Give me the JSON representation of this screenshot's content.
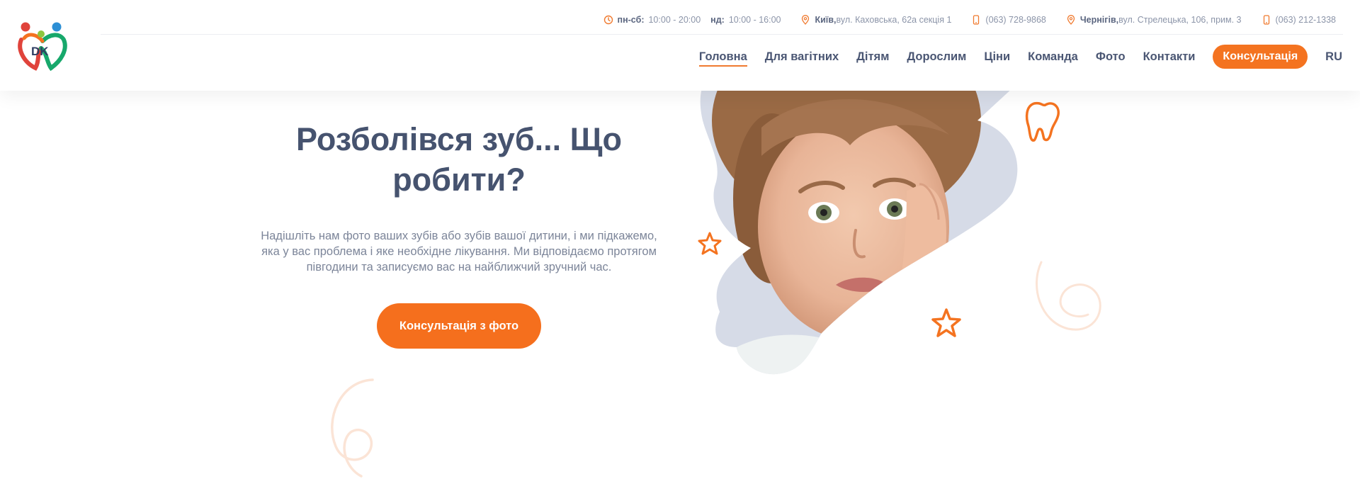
{
  "brand": {
    "logo_text": "DK",
    "colors": {
      "accent": "#f47320",
      "text": "#46536f",
      "muted": "#7c8599",
      "logo_red": "#e0433b",
      "logo_green": "#17a86b",
      "logo_blue": "#2d8fd5"
    }
  },
  "topbar": {
    "hours_label_weekdays": "пн-сб:",
    "hours_weekdays": "10:00 - 20:00",
    "hours_label_sunday": "нд:",
    "hours_sunday": "10:00 - 16:00",
    "kyiv_city": "Київ,",
    "kyiv_address": "вул. Каховська, 62а секція 1",
    "kyiv_phone": "(063) 728-9868",
    "chernihiv_city": "Чернігів,",
    "chernihiv_address": "вул. Стрелецька, 106, прим. 3",
    "chernihiv_phone": "(063) 212-1338",
    "icons": [
      "clock-icon",
      "location-pin-icon",
      "phone-icon"
    ]
  },
  "nav": {
    "items": [
      "Головна",
      "Для вагітних",
      "Дітям",
      "Дорослим",
      "Ціни",
      "Команда",
      "Фото",
      "Контакти"
    ],
    "active_index": 0,
    "cta": "Консультація",
    "lang": "RU"
  },
  "hero": {
    "title": "Розболівся зуб... Що робити?",
    "text": "Надішліть нам фото ваших зубів або зубів вашої дитини, і ми підкажемо, яка у вас проблема і яке необхідне лікування. Ми відповідаємо протягом півгодини та записуємо вас на найближчий зручний час.",
    "button": "Консультація з фото"
  }
}
